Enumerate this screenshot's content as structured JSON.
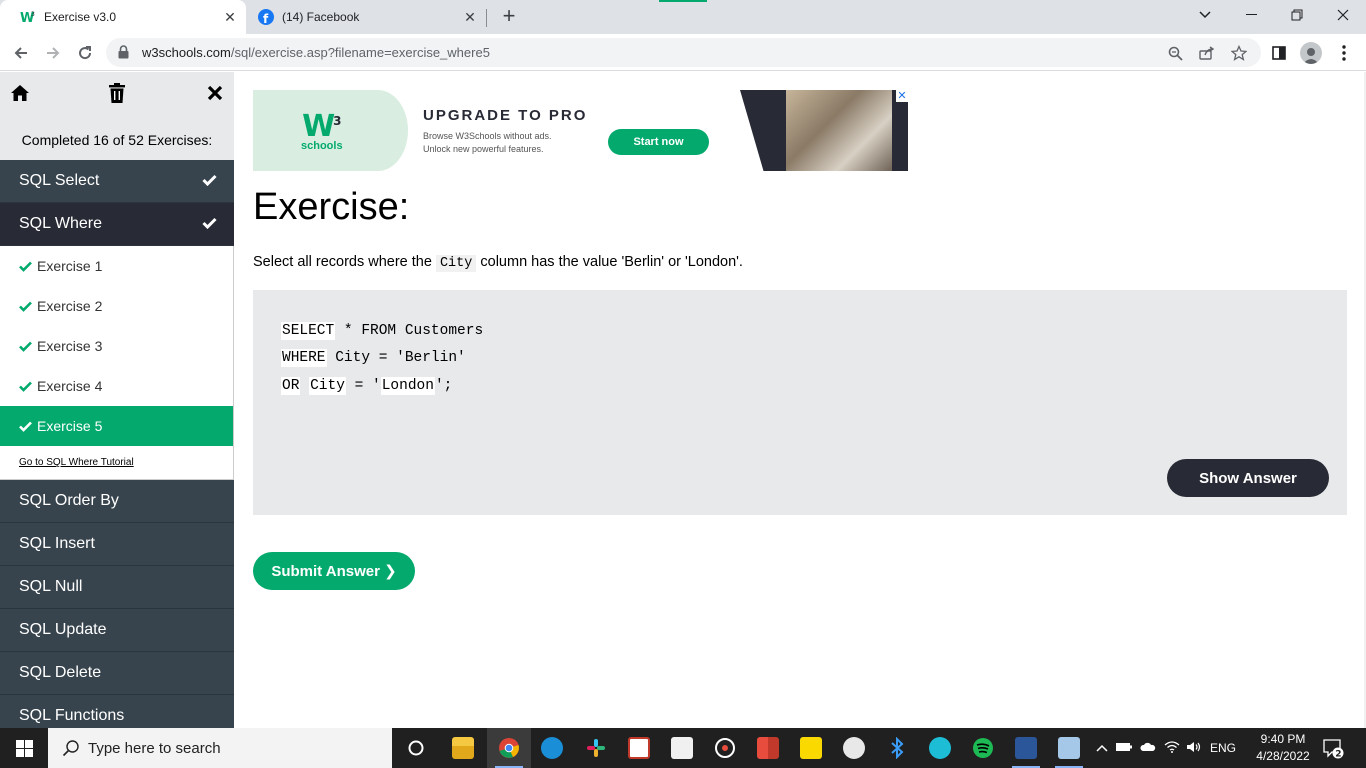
{
  "browser": {
    "tabs": [
      {
        "title": "Exercise v3.0",
        "active": true
      },
      {
        "title": "(14) Facebook",
        "active": false
      }
    ],
    "url_host": "w3schools.com",
    "url_path": "/sql/exercise.asp?filename=exercise_where5"
  },
  "sidebar": {
    "progress": "Completed 16 of 52 Exercises:",
    "categories_before": [
      {
        "label": "SQL Select",
        "done": true
      }
    ],
    "open_category": {
      "label": "SQL Where",
      "done": true
    },
    "exercises": [
      {
        "label": "Exercise 1",
        "active": false
      },
      {
        "label": "Exercise 2",
        "active": false
      },
      {
        "label": "Exercise 3",
        "active": false
      },
      {
        "label": "Exercise 4",
        "active": false
      },
      {
        "label": "Exercise 5",
        "active": true
      }
    ],
    "tutorial_link": "Go to SQL Where Tutorial",
    "categories_after": [
      "SQL Order By",
      "SQL Insert",
      "SQL Null",
      "SQL Update",
      "SQL Delete",
      "SQL Functions"
    ]
  },
  "ad": {
    "logo_text": "W",
    "logo_sup": "3",
    "logo_sub": "schools",
    "headline": "UPGRADE TO PRO",
    "sub_line1": "Browse W3Schools without ads.",
    "sub_line2": "Unlock new powerful features.",
    "cta": "Start now",
    "close": "✕"
  },
  "exercise": {
    "title": "Exercise:",
    "desc_before": "Select all records where the ",
    "desc_code": "City",
    "desc_after": " column has the value 'Berlin' or 'London'.",
    "code": {
      "l1_blank": "SELECT",
      "l1_rest": " * FROM Customers",
      "l2_blank": "WHERE",
      "l2_rest": " City = 'Berlin'",
      "l3_blank1": "OR",
      "l3_blank2": "City",
      "l3_mid": " = '",
      "l3_blank3": "London",
      "l3_end": "';"
    },
    "show_answer": "Show Answer",
    "submit": "Submit Answer ❯"
  },
  "taskbar": {
    "search_placeholder": "Type here to search",
    "lang": "ENG",
    "time": "9:40 PM",
    "date": "4/28/2022",
    "notifications": "2"
  },
  "colors": {
    "accent": "#04aa6d",
    "sidebar_dark": "#38444d",
    "dark": "#282a35"
  }
}
